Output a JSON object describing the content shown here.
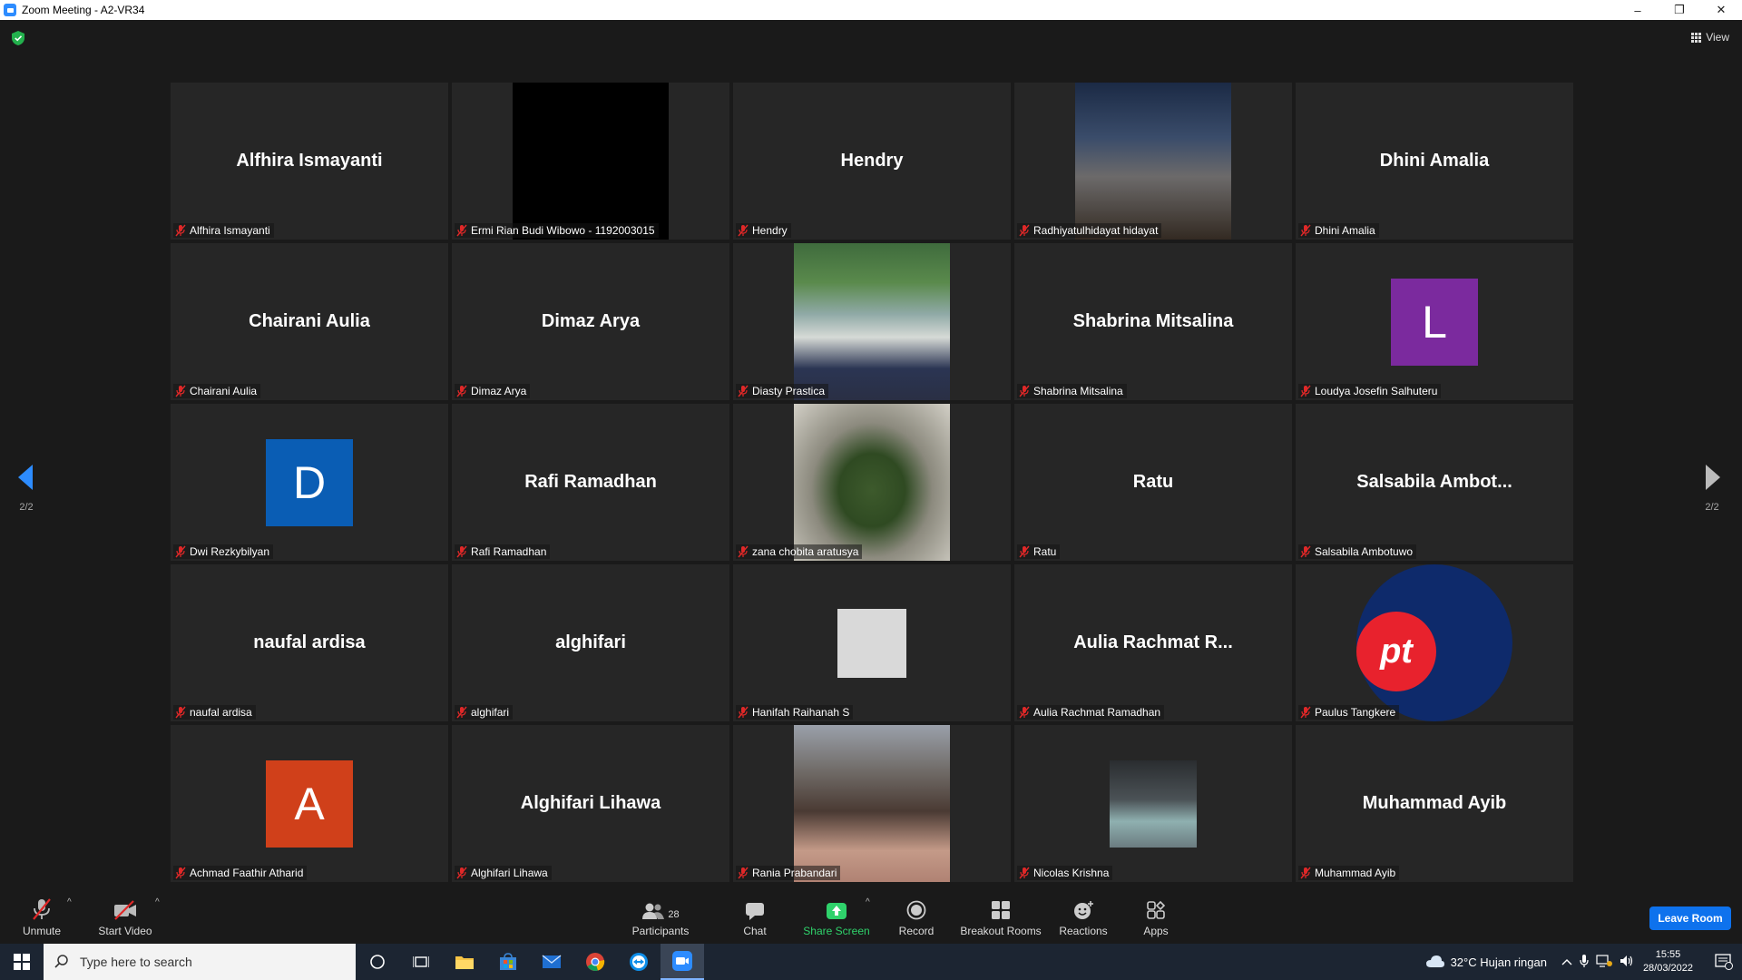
{
  "window": {
    "title": "Zoom Meeting - A2-VR34",
    "minimize": "–",
    "restore": "❐",
    "close": "✕"
  },
  "view_button": {
    "label": "View"
  },
  "pagination": {
    "left": "2/2",
    "right": "2/2"
  },
  "tiles": [
    {
      "big": "Alfhira Ismayanti",
      "label": "Alfhira Ismayanti"
    },
    {
      "big": "",
      "label": "Ermi Rian Budi Wibowo - 1192003015"
    },
    {
      "big": "Hendry",
      "label": "Hendry"
    },
    {
      "big": "",
      "label": "Radhiyatulhidayat hidayat"
    },
    {
      "big": "Dhini Amalia",
      "label": "Dhini Amalia"
    },
    {
      "big": "Chairani Aulia",
      "label": "Chairani Aulia"
    },
    {
      "big": "Dimaz Arya",
      "label": "Dimaz Arya"
    },
    {
      "big": "",
      "label": "Diasty Prastica"
    },
    {
      "big": "Shabrina Mitsalina",
      "label": "Shabrina Mitsalina"
    },
    {
      "big": "L",
      "label": "Loudya Josefin Salhuteru",
      "color": "#7b2a9e"
    },
    {
      "big": "D",
      "label": "Dwi Rezkybilyan",
      "color": "#0a5db4"
    },
    {
      "big": "Rafi Ramadhan",
      "label": "Rafi Ramadhan"
    },
    {
      "big": "",
      "label": "zana chobita aratusya"
    },
    {
      "big": "Ratu",
      "label": "Ratu"
    },
    {
      "big": "Salsabila  Ambot...",
      "label": "Salsabila Ambotuwo"
    },
    {
      "big": "naufal ardisa",
      "label": "naufal ardisa"
    },
    {
      "big": "alghifari",
      "label": "alghifari"
    },
    {
      "big": "",
      "label": "Hanifah Raihanah S"
    },
    {
      "big": "Aulia  Rachmat  R...",
      "label": "Aulia Rachmat Ramadhan"
    },
    {
      "big": "pt",
      "label": "Paulus Tangkere"
    },
    {
      "big": "A",
      "label": "Achmad Faathir Atharid",
      "color": "#d0401a"
    },
    {
      "big": "Alghifari Lihawa",
      "label": "Alghifari Lihawa"
    },
    {
      "big": "",
      "label": "Rania Prabandari"
    },
    {
      "big": "",
      "label": "Nicolas Krishna"
    },
    {
      "big": "Muhammad Ayib",
      "label": "Muhammad Ayib"
    }
  ],
  "toolbar": {
    "unmute": "Unmute",
    "start_video": "Start Video",
    "participants": "Participants",
    "participants_count": "28",
    "chat": "Chat",
    "share_screen": "Share Screen",
    "record": "Record",
    "breakout_rooms": "Breakout Rooms",
    "reactions": "Reactions",
    "apps": "Apps",
    "leave_room": "Leave Room"
  },
  "taskbar": {
    "search_placeholder": "Type here to search",
    "weather": "32°C  Hujan ringan",
    "time": "15:55",
    "date": "28/03/2022",
    "notification_count": "1"
  },
  "colors": {
    "accent": "#0e72ed",
    "share_green": "#2fd26b",
    "muted_red": "#e02828",
    "background": "#1a1a1a",
    "tile": "#262626"
  }
}
